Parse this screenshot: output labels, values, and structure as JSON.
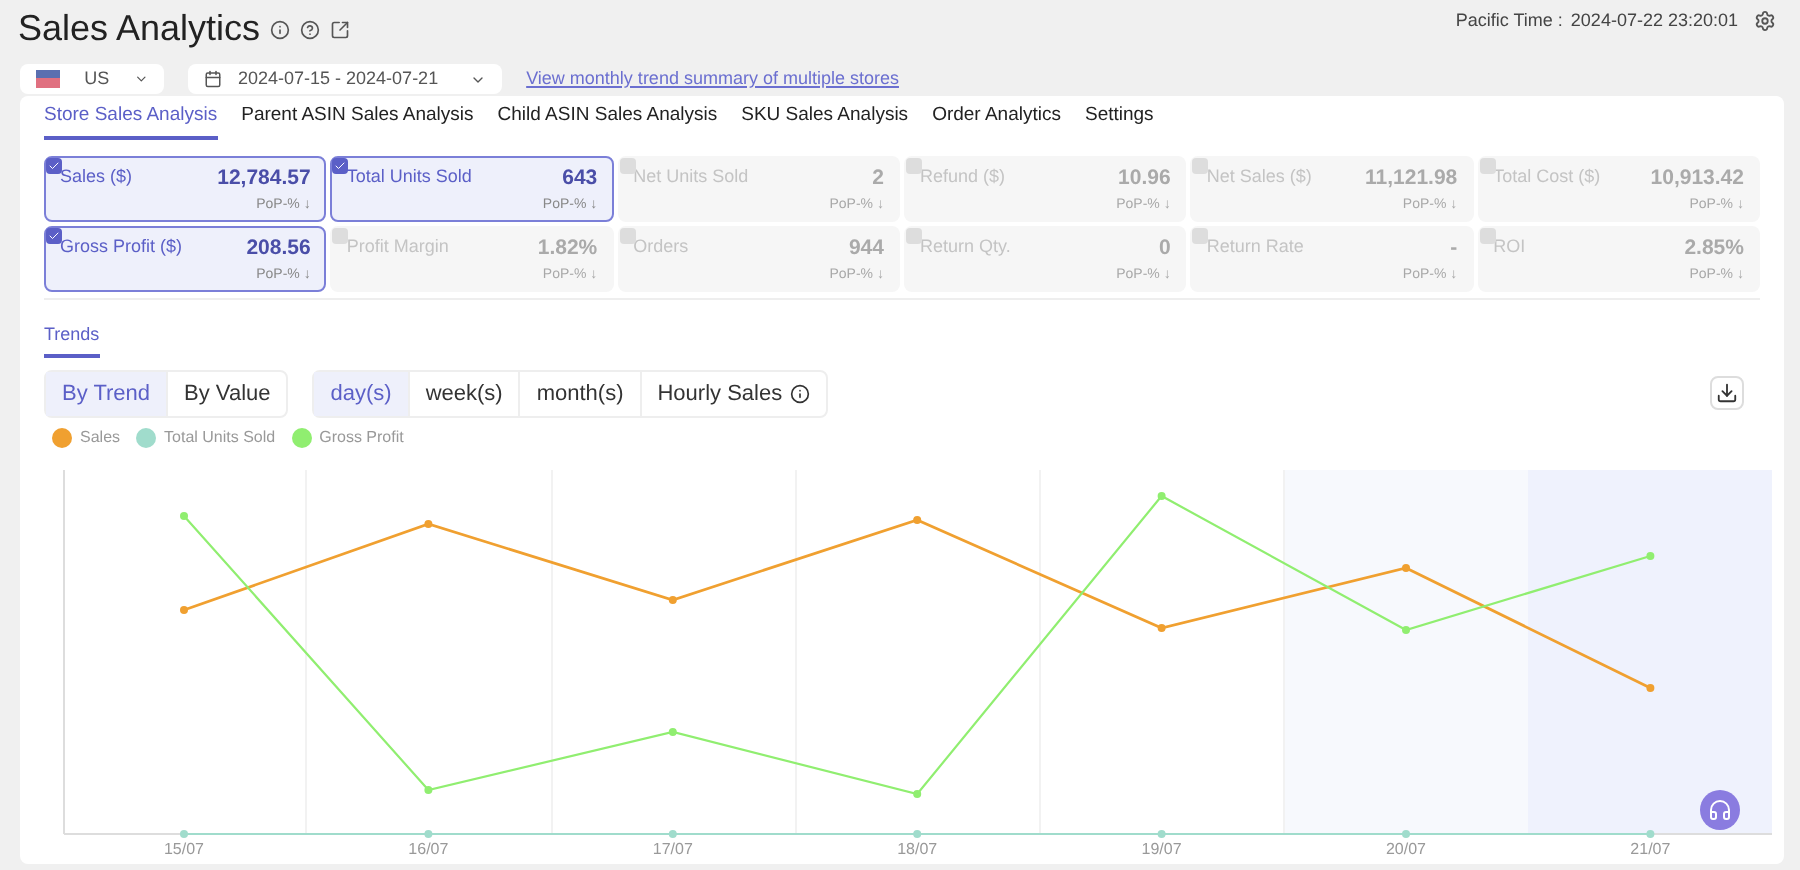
{
  "header": {
    "title": "Sales Analytics",
    "time_label": "Pacific Time :",
    "time_value": "2024-07-22 23:20:01"
  },
  "filters": {
    "marketplace": "US",
    "date_range": "2024-07-15 - 2024-07-21",
    "link": "View monthly trend summary of multiple stores"
  },
  "tabs": [
    {
      "label": "Store Sales Analysis",
      "selected": true
    },
    {
      "label": "Parent ASIN Sales Analysis",
      "selected": false
    },
    {
      "label": "Child ASIN Sales Analysis",
      "selected": false
    },
    {
      "label": "SKU Sales Analysis",
      "selected": false
    },
    {
      "label": "Order Analytics",
      "selected": false
    },
    {
      "label": "Settings",
      "selected": false
    }
  ],
  "metrics": [
    {
      "label": "Sales ($)",
      "value": "12,784.57",
      "pop": "PoP-% ↓",
      "selected": true
    },
    {
      "label": "Total Units Sold",
      "value": "643",
      "pop": "PoP-% ↓",
      "selected": true
    },
    {
      "label": "Net Units Sold",
      "value": "2",
      "pop": "PoP-% ↓",
      "selected": false
    },
    {
      "label": "Refund ($)",
      "value": "10.96",
      "pop": "PoP-% ↓",
      "selected": false
    },
    {
      "label": "Net Sales ($)",
      "value": "11,121.98",
      "pop": "PoP-% ↓",
      "selected": false
    },
    {
      "label": "Total Cost ($)",
      "value": "10,913.42",
      "pop": "PoP-% ↓",
      "selected": false
    },
    {
      "label": "Gross Profit ($)",
      "value": "208.56",
      "pop": "PoP-% ↓",
      "selected": true
    },
    {
      "label": "Profit Margin",
      "value": "1.82%",
      "pop": "PoP-% ↓",
      "selected": false
    },
    {
      "label": "Orders",
      "value": "944",
      "pop": "PoP-% ↓",
      "selected": false
    },
    {
      "label": "Return Qty.",
      "value": "0",
      "pop": "PoP-% ↓",
      "selected": false
    },
    {
      "label": "Return Rate",
      "value": "-",
      "pop": "PoP-% ↓",
      "selected": false
    },
    {
      "label": "ROI",
      "value": "2.85%",
      "pop": "PoP-% ↓",
      "selected": false
    }
  ],
  "trends": {
    "title": "Trends",
    "view_modes": [
      {
        "label": "By Trend",
        "selected": true
      },
      {
        "label": "By Value",
        "selected": false
      }
    ],
    "periods": [
      {
        "label": "day(s)",
        "selected": true
      },
      {
        "label": "week(s)",
        "selected": false
      },
      {
        "label": "month(s)",
        "selected": false
      },
      {
        "label": "Hourly Sales",
        "selected": false
      }
    ],
    "legend": [
      {
        "label": "Sales",
        "color": "#f0a030"
      },
      {
        "label": "Total Units Sold",
        "color": "#a0dccc"
      },
      {
        "label": "Gross Profit",
        "color": "#90ee70"
      }
    ],
    "x_labels": [
      "15/07",
      "16/07",
      "17/07",
      "18/07",
      "19/07",
      "20/07",
      "21/07"
    ]
  }
}
